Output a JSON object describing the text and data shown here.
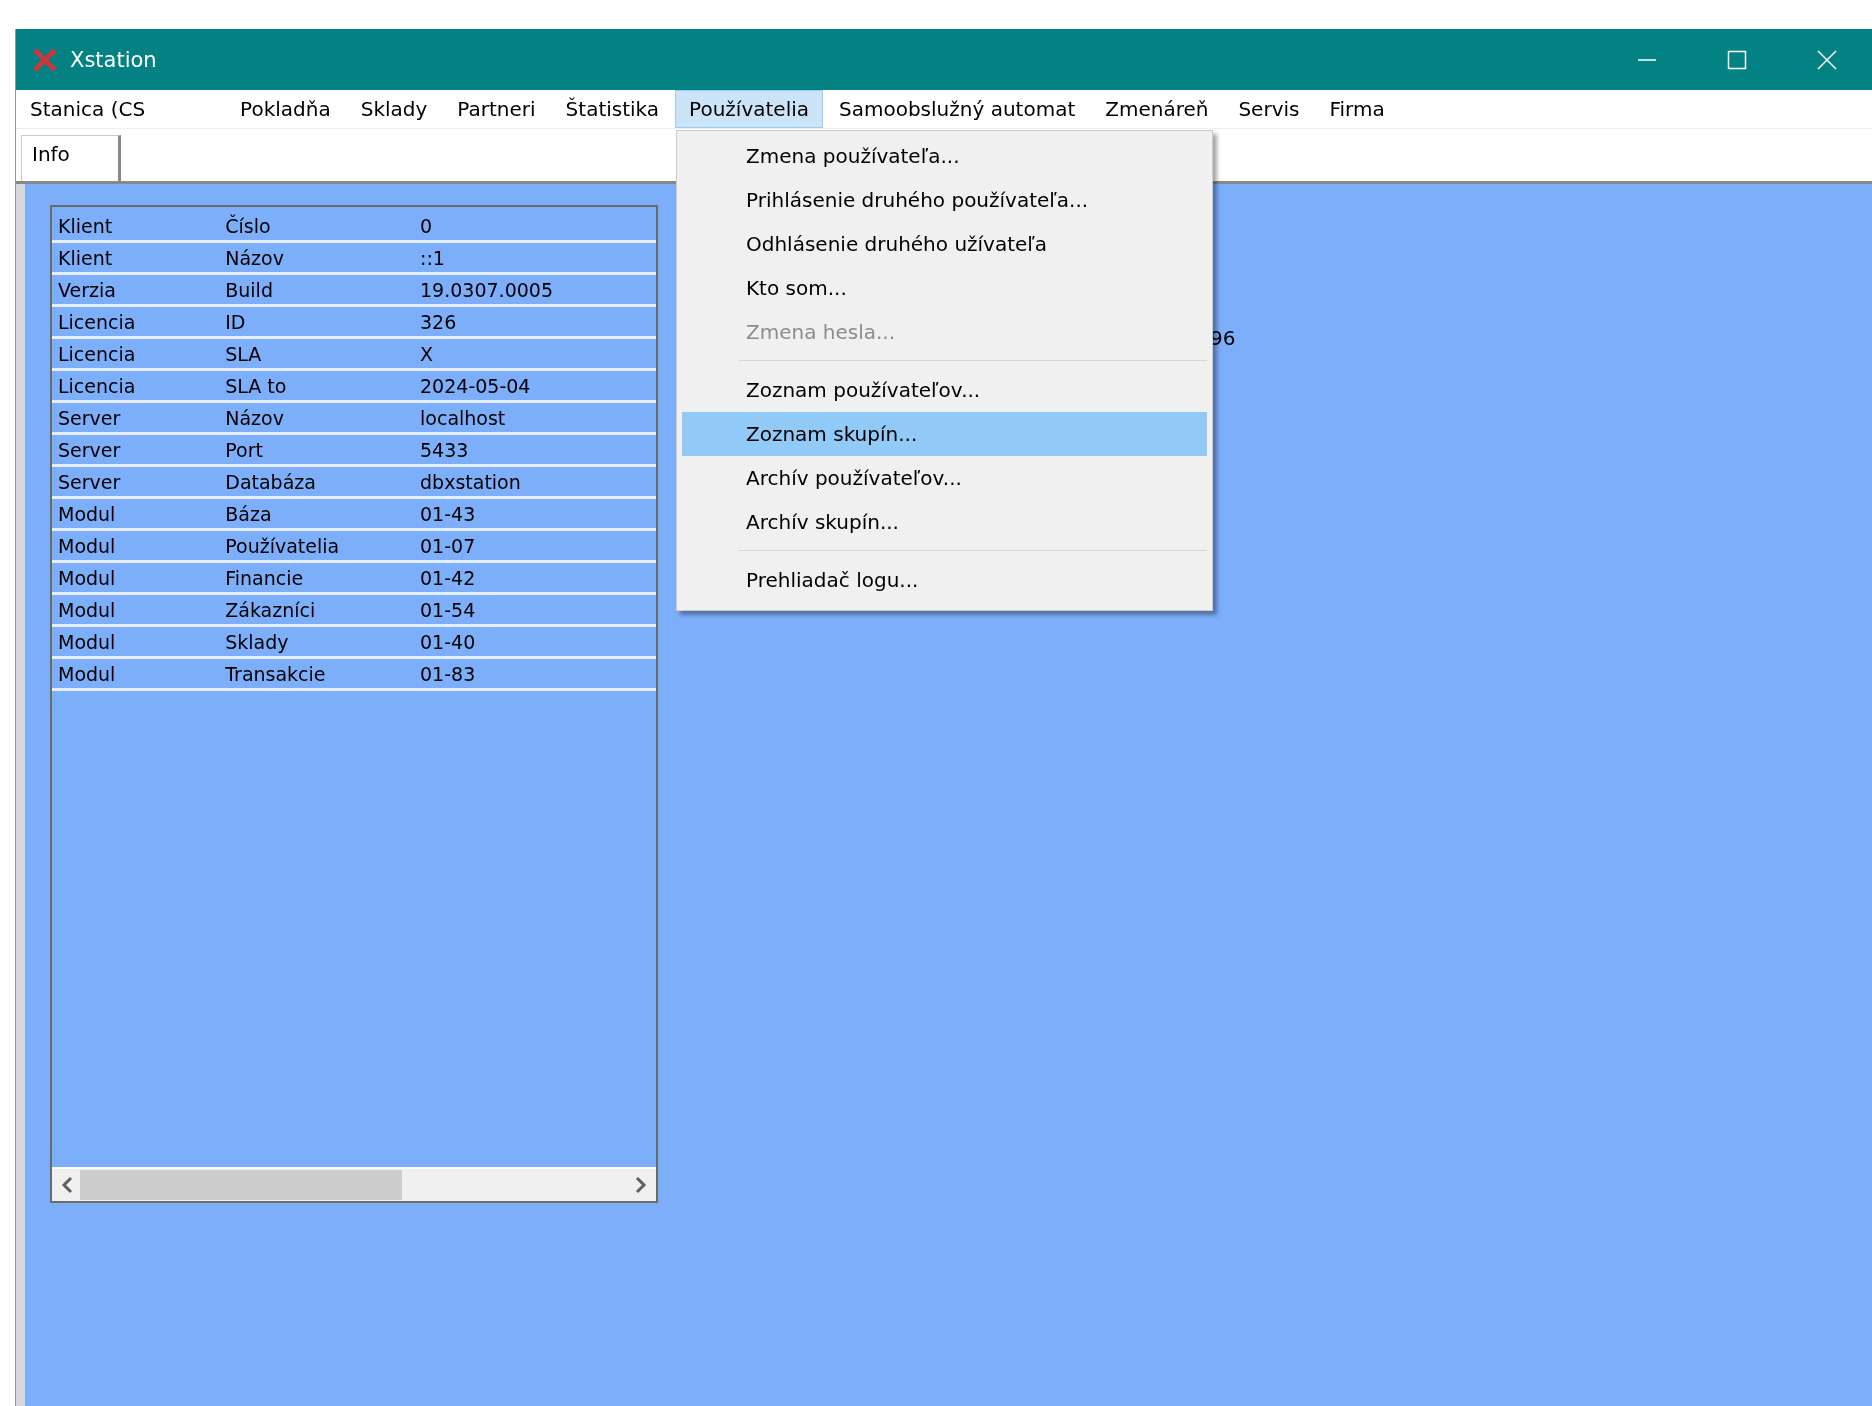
{
  "window": {
    "title": "Xstation"
  },
  "menu_bar": [
    {
      "label": "Stanica (CS",
      "selected": false
    },
    {
      "label": "Pokladňa",
      "selected": false
    },
    {
      "label": "Sklady",
      "selected": false
    },
    {
      "label": "Partneri",
      "selected": false
    },
    {
      "label": "Štatistika",
      "selected": false
    },
    {
      "label": "Používatelia",
      "selected": true
    },
    {
      "label": "Samoobslužný automat",
      "selected": false
    },
    {
      "label": "Zmenáreň",
      "selected": false
    },
    {
      "label": "Servis",
      "selected": false
    },
    {
      "label": "Firma",
      "selected": false
    }
  ],
  "dropdown": [
    {
      "kind": "item",
      "label": "Zmena používateľa...",
      "disabled": false,
      "selected": false
    },
    {
      "kind": "item",
      "label": "Prihlásenie druhého používateľa...",
      "disabled": false,
      "selected": false
    },
    {
      "kind": "item",
      "label": "Odhlásenie druhého užívateľa",
      "disabled": false,
      "selected": false
    },
    {
      "kind": "item",
      "label": "Kto som...",
      "disabled": false,
      "selected": false
    },
    {
      "kind": "item",
      "label": "Zmena hesla...",
      "disabled": true,
      "selected": false
    },
    {
      "kind": "separator"
    },
    {
      "kind": "item",
      "label": "Zoznam používateľov...",
      "disabled": false,
      "selected": false
    },
    {
      "kind": "item",
      "label": "Zoznam skupín...",
      "disabled": false,
      "selected": true
    },
    {
      "kind": "item",
      "label": "Archív používateľov...",
      "disabled": false,
      "selected": false
    },
    {
      "kind": "item",
      "label": "Archív skupín...",
      "disabled": false,
      "selected": false
    },
    {
      "kind": "separator"
    },
    {
      "kind": "item",
      "label": "Prehliadač logu...",
      "disabled": false,
      "selected": false
    }
  ],
  "tabs": [
    {
      "label": "Info",
      "selected": true
    }
  ],
  "info_table": {
    "rows": [
      [
        "Klient",
        "Číslo",
        "0"
      ],
      [
        "Klient",
        "Názov",
        "::1"
      ],
      [
        "Verzia",
        "Build",
        "19.0307.0005"
      ],
      [
        "Licencia",
        "ID",
        "326"
      ],
      [
        "Licencia",
        "SLA",
        "X"
      ],
      [
        "Licencia",
        "SLA to",
        "2024-05-04"
      ],
      [
        "Server",
        "Názov",
        "localhost"
      ],
      [
        "Server",
        "Port",
        "5433"
      ],
      [
        "Server",
        "Databáza",
        "dbxstation"
      ],
      [
        "Modul",
        "Báza",
        "01-43"
      ],
      [
        "Modul",
        "Používatelia",
        "01-07"
      ],
      [
        "Modul",
        "Financie",
        "01-42"
      ],
      [
        "Modul",
        "Zákazníci",
        "01-54"
      ],
      [
        "Modul",
        "Sklady",
        "01-40"
      ],
      [
        "Modul",
        "Transakcie",
        "01-83"
      ]
    ]
  },
  "background_text": "96"
}
